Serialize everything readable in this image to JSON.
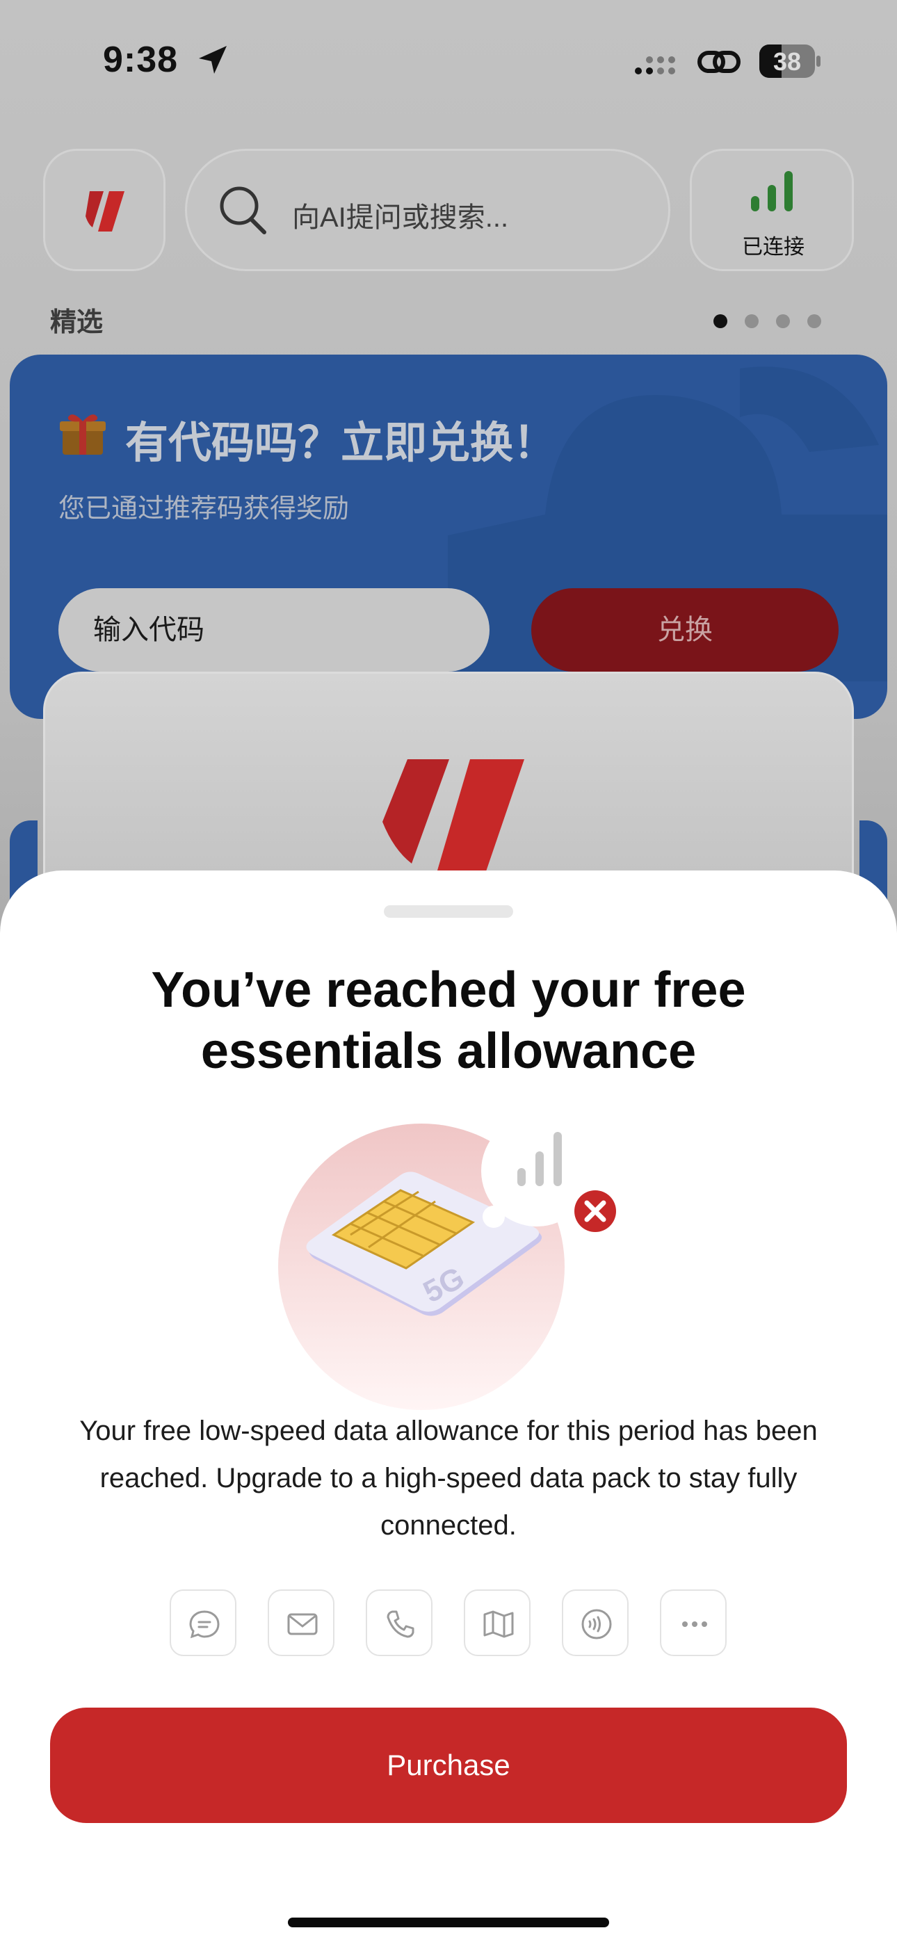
{
  "status_bar": {
    "time": "9:38",
    "battery": "38"
  },
  "top_bar": {
    "search_placeholder": "向AI提问或搜索...",
    "connection_status": "已连接"
  },
  "section_label": "精选",
  "promo": {
    "title": "有代码吗？立即兑换！",
    "subtitle": "您已通过推荐码获得奖励",
    "input_placeholder": "输入代码",
    "redeem_label": "兑换"
  },
  "sheet": {
    "title": "You’ve reached your free essentials allowance",
    "sim_label": "5G",
    "body": "Your free low-speed data allowance for this period has been reached. Upgrade to a high-speed data pack to stay fully connected.",
    "features": [
      "message-icon",
      "mail-icon",
      "phone-icon",
      "map-icon",
      "nfc-icon",
      "more-icon"
    ],
    "purchase_label": "Purchase"
  },
  "colors": {
    "accent": "#c62828",
    "promo_blue": "#2b5597"
  }
}
